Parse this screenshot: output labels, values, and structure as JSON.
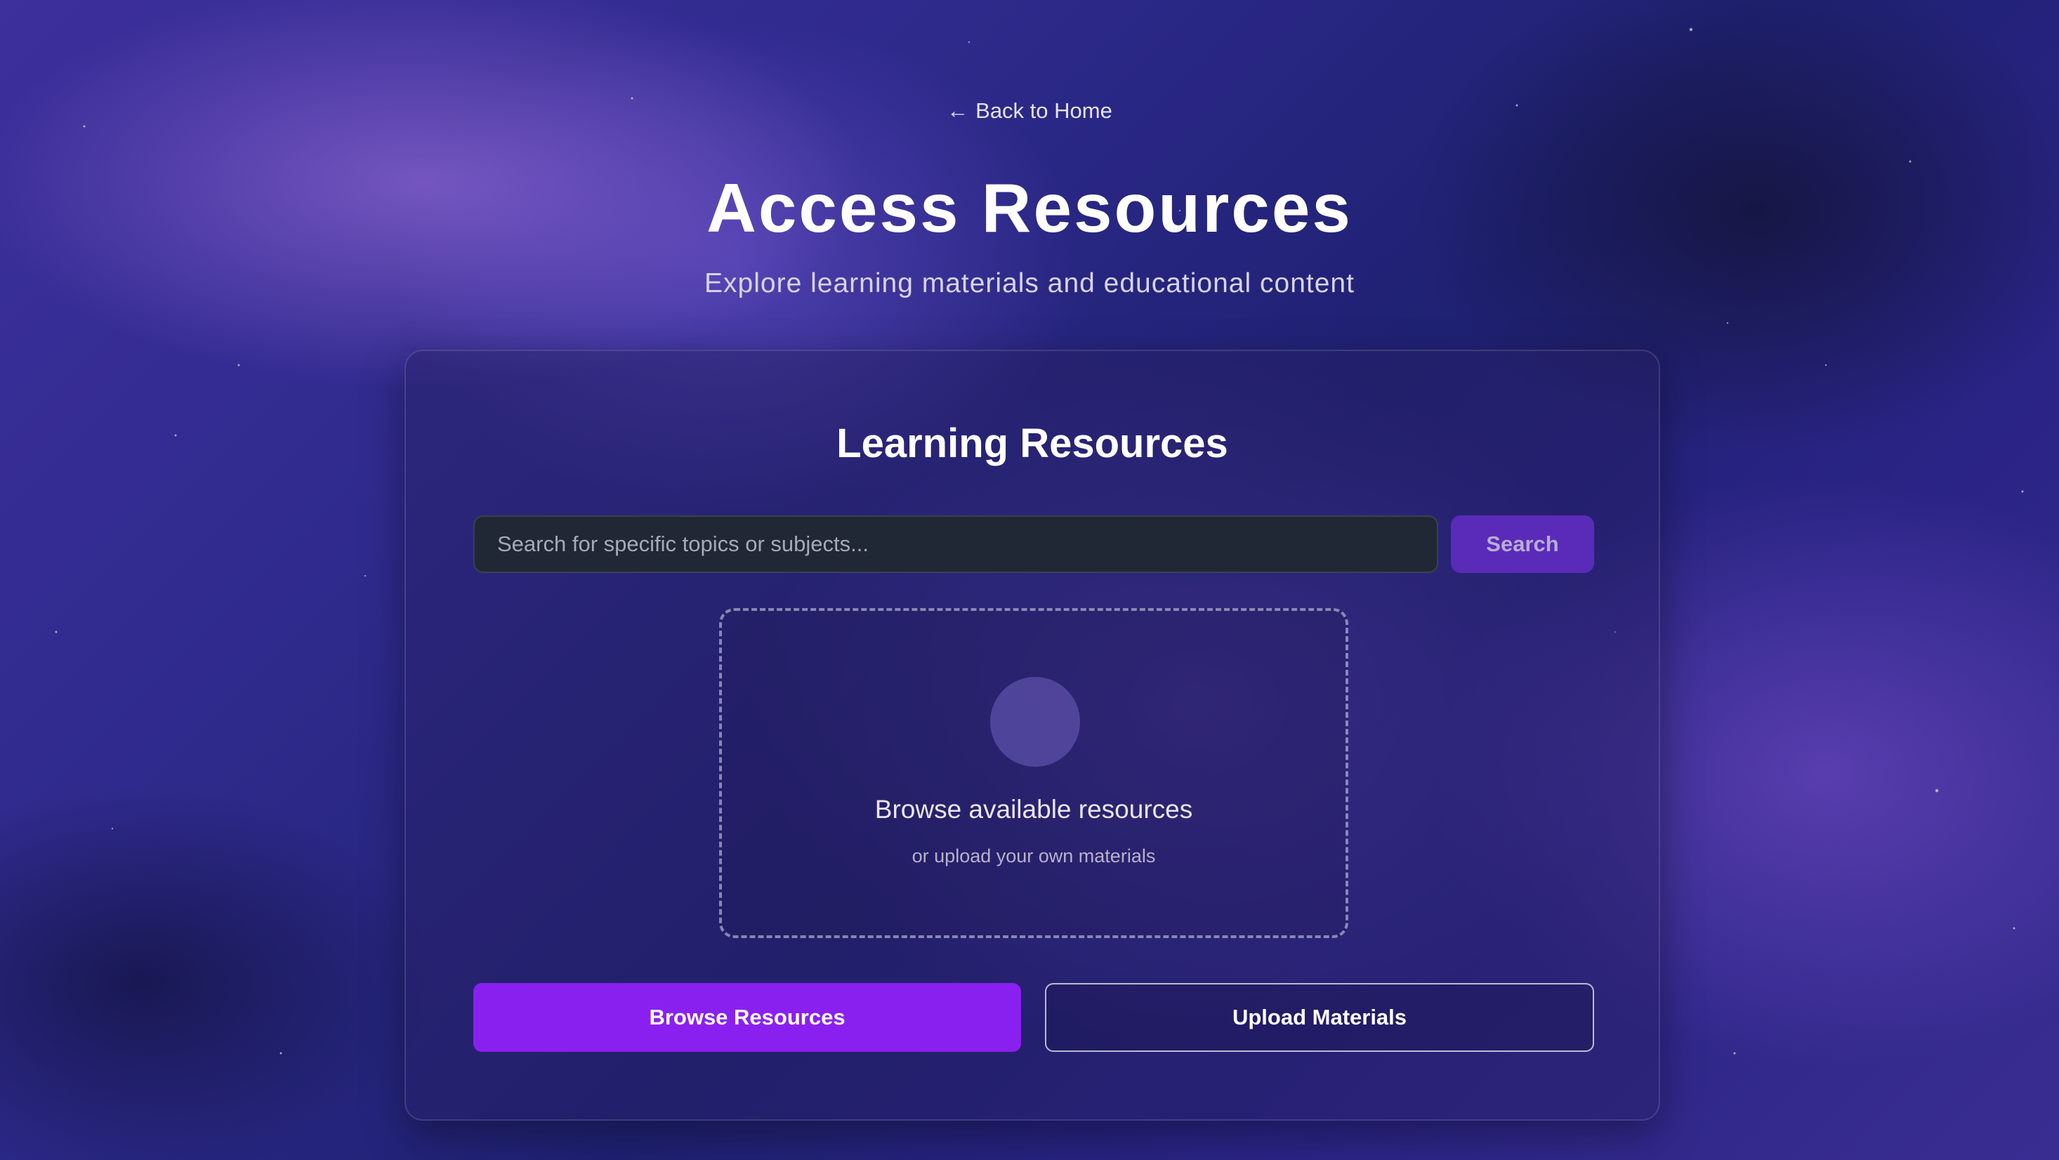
{
  "nav": {
    "back_arrow": "←",
    "back_label": "Back to Home"
  },
  "hero": {
    "title": "Access Resources",
    "subtitle": "Explore learning materials and educational content"
  },
  "card": {
    "title": "Learning Resources",
    "search": {
      "placeholder": "Search for specific topics or subjects...",
      "value": "",
      "button_label": "Search"
    },
    "dropzone": {
      "icon": "circle-icon",
      "title": "Browse available resources",
      "subtitle": "or upload your own materials"
    },
    "actions": {
      "browse_label": "Browse Resources",
      "upload_label": "Upload Materials"
    }
  },
  "colors": {
    "accent": "#8a20f0",
    "search_button": "#5a2bb8",
    "input_bg": "#1f2834"
  }
}
